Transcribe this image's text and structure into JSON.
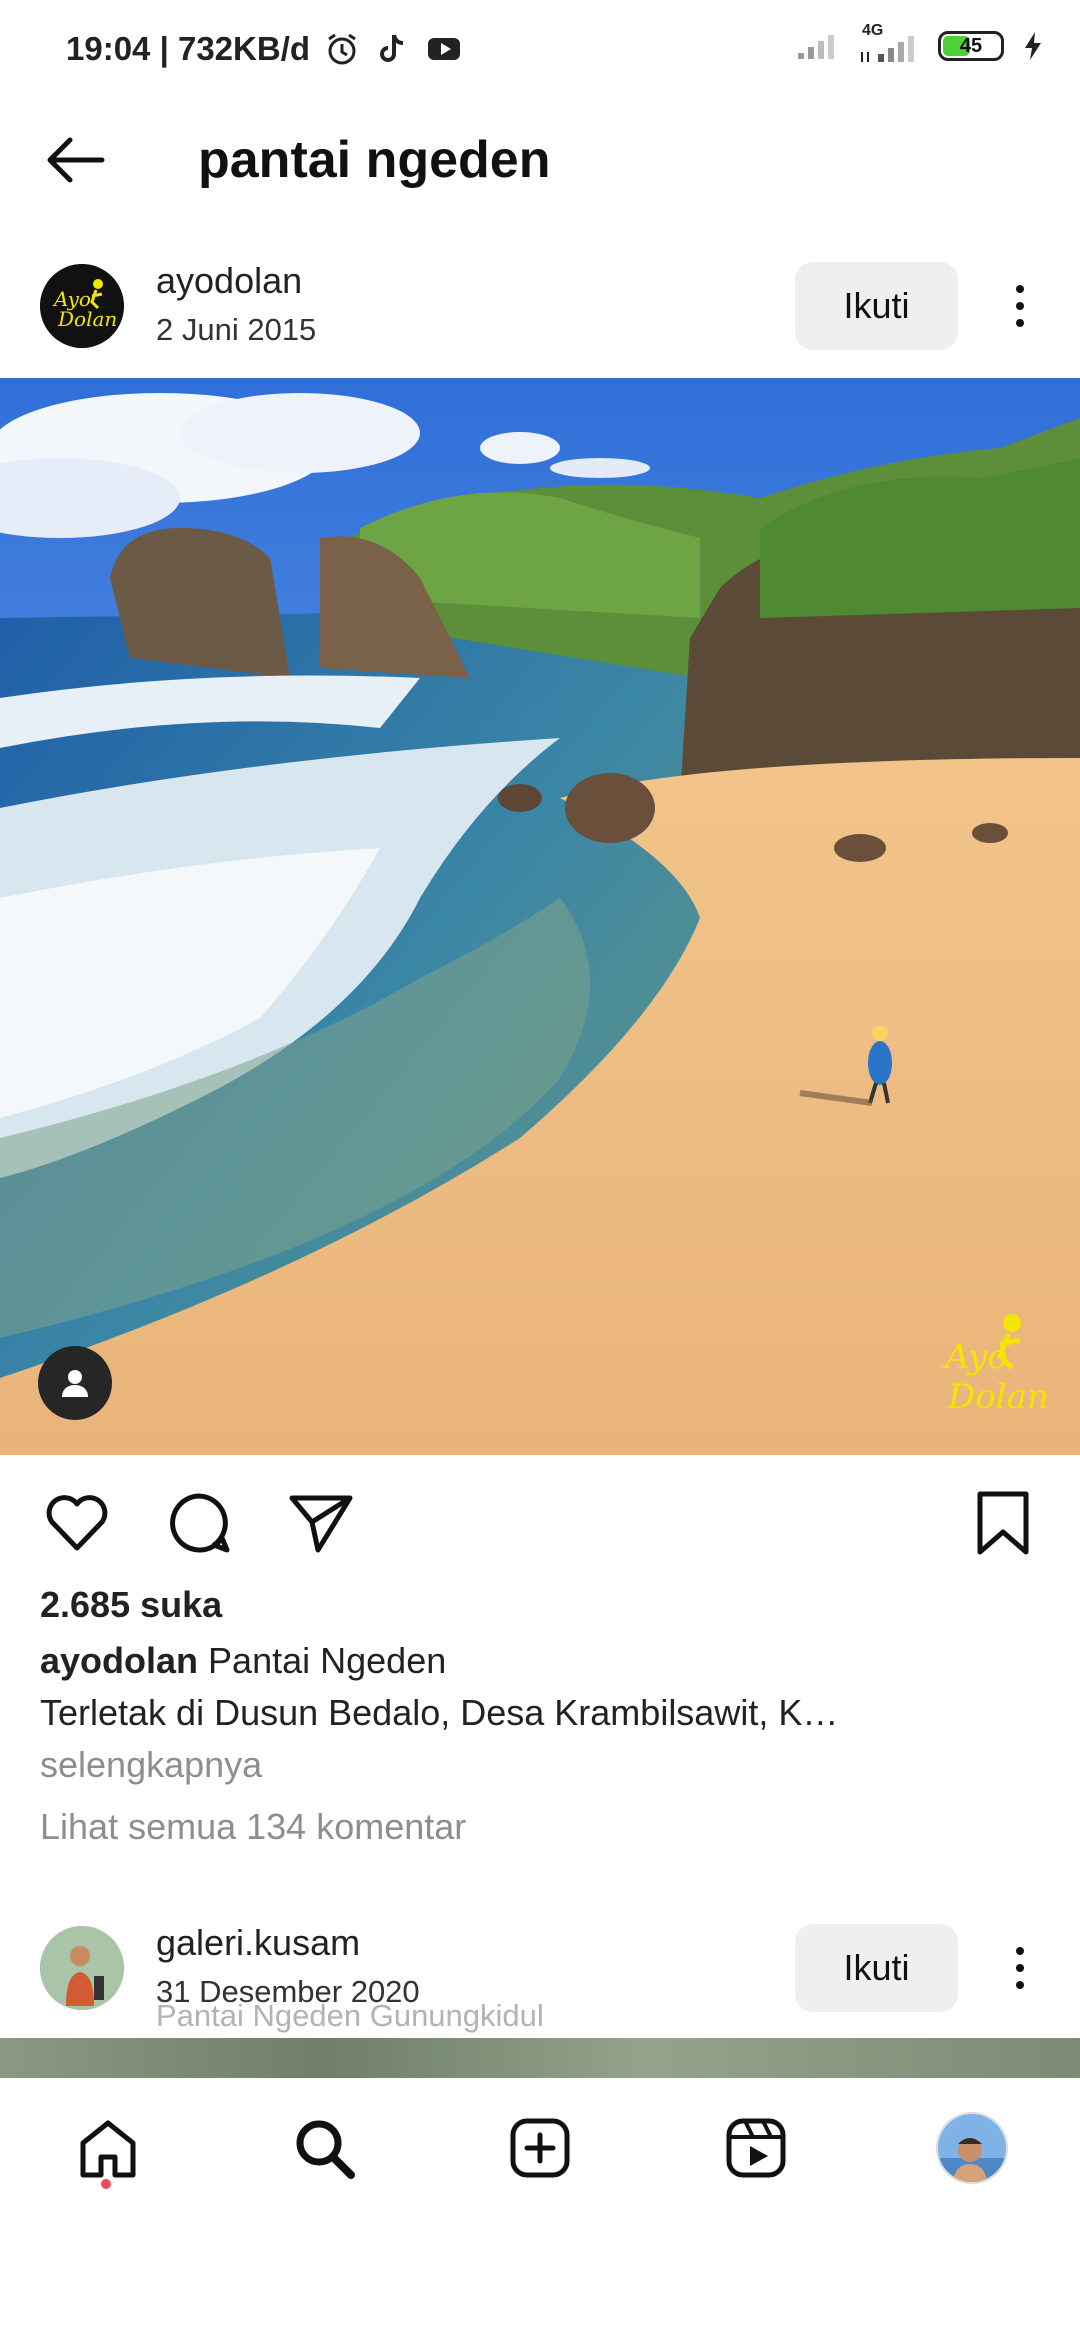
{
  "status_bar": {
    "time_speed": "19:04 | 732KB/d",
    "battery_level": "45",
    "network_label": "4G",
    "icons": [
      "alarm-icon",
      "tiktok-icon",
      "youtube-icon",
      "signal-icon",
      "battery-icon",
      "charging-icon"
    ]
  },
  "header": {
    "title": "pantai ngeden",
    "back_icon": "arrow-left-icon"
  },
  "post1": {
    "username": "ayodolan",
    "date": "2 Juni 2015",
    "follow_label": "Ikuti",
    "avatar_text": "Ayo Dolan",
    "watermark_text": "Ayo Dolan",
    "likes": "2.685 suka",
    "caption_user": "ayodolan",
    "caption_title": "Pantai Ngeden",
    "caption_body": "Terletak di Dusun Bedalo, Desa Krambilsawit, K…",
    "more_label": "selengkapnya",
    "comments_link": "Lihat semua 134 komentar"
  },
  "post2": {
    "username": "galeri.kusam",
    "date": "31 Desember 2020",
    "location": "Pantai Ngeden Gunungkidul",
    "follow_label": "Ikuti"
  },
  "bottom_nav": {
    "items": [
      "home-icon",
      "search-icon",
      "add-post-icon",
      "reels-icon",
      "profile-avatar"
    ]
  },
  "colors": {
    "follow_bg": "#efefef",
    "secondary_text": "#8e8e8e",
    "notification_dot": "#ed4956",
    "battery_fill": "#4cd137",
    "brand_yellow": "#f2e600"
  }
}
